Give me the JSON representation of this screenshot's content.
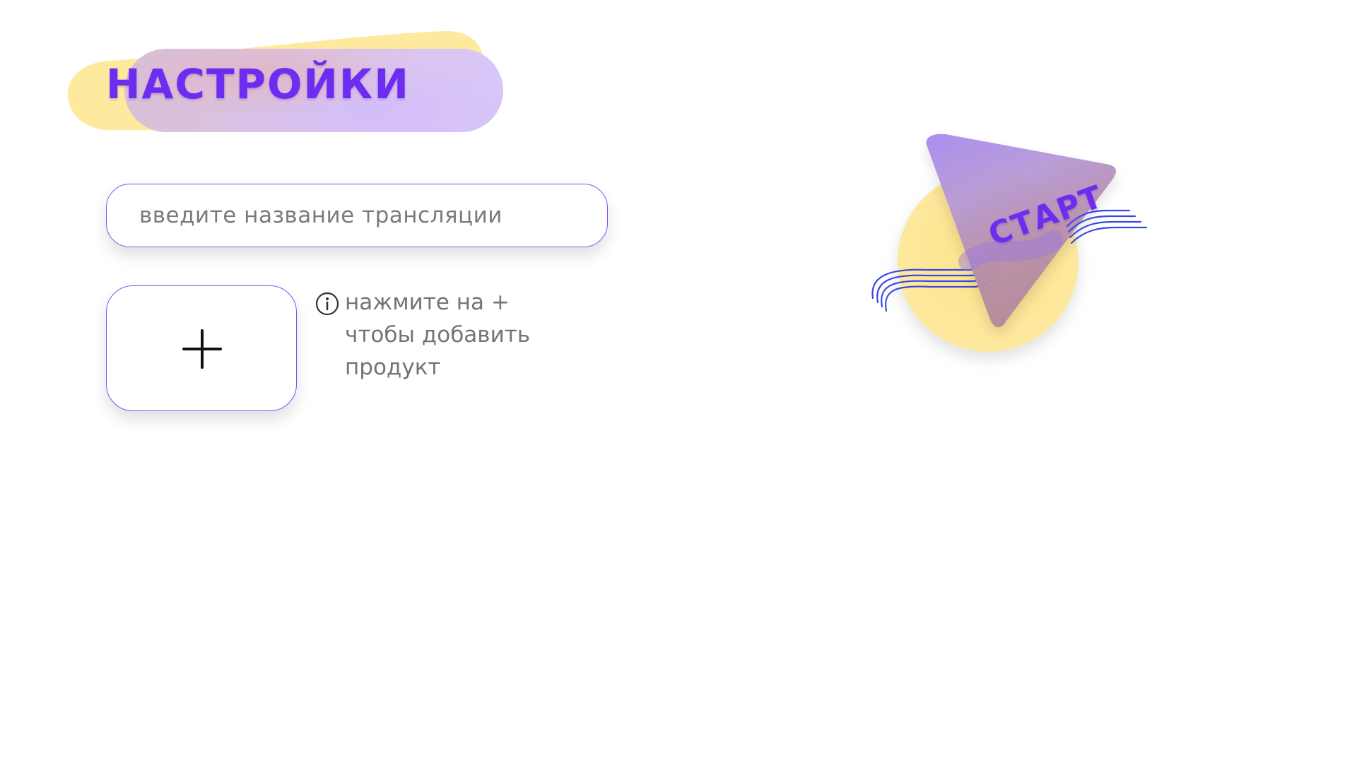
{
  "header": {
    "title": "НАСТРОЙКИ"
  },
  "stream": {
    "placeholder": "введите название трансляции",
    "value": ""
  },
  "product": {
    "add_symbol": "+",
    "hint_lines": [
      "нажмите на +",
      "чтобы добавить",
      "продукт"
    ]
  },
  "start": {
    "label": "СТАРТ"
  },
  "icons": {
    "add": "plus-icon",
    "info": "info-icon",
    "start": "triangle-play-icon"
  },
  "colors": {
    "accent": "#6d2cf0",
    "border": "#8a4cf0",
    "yellow": "#fde99a",
    "lavender": "#d8c7fb",
    "wave": "#3a48e6",
    "hint_text": "#747474"
  }
}
